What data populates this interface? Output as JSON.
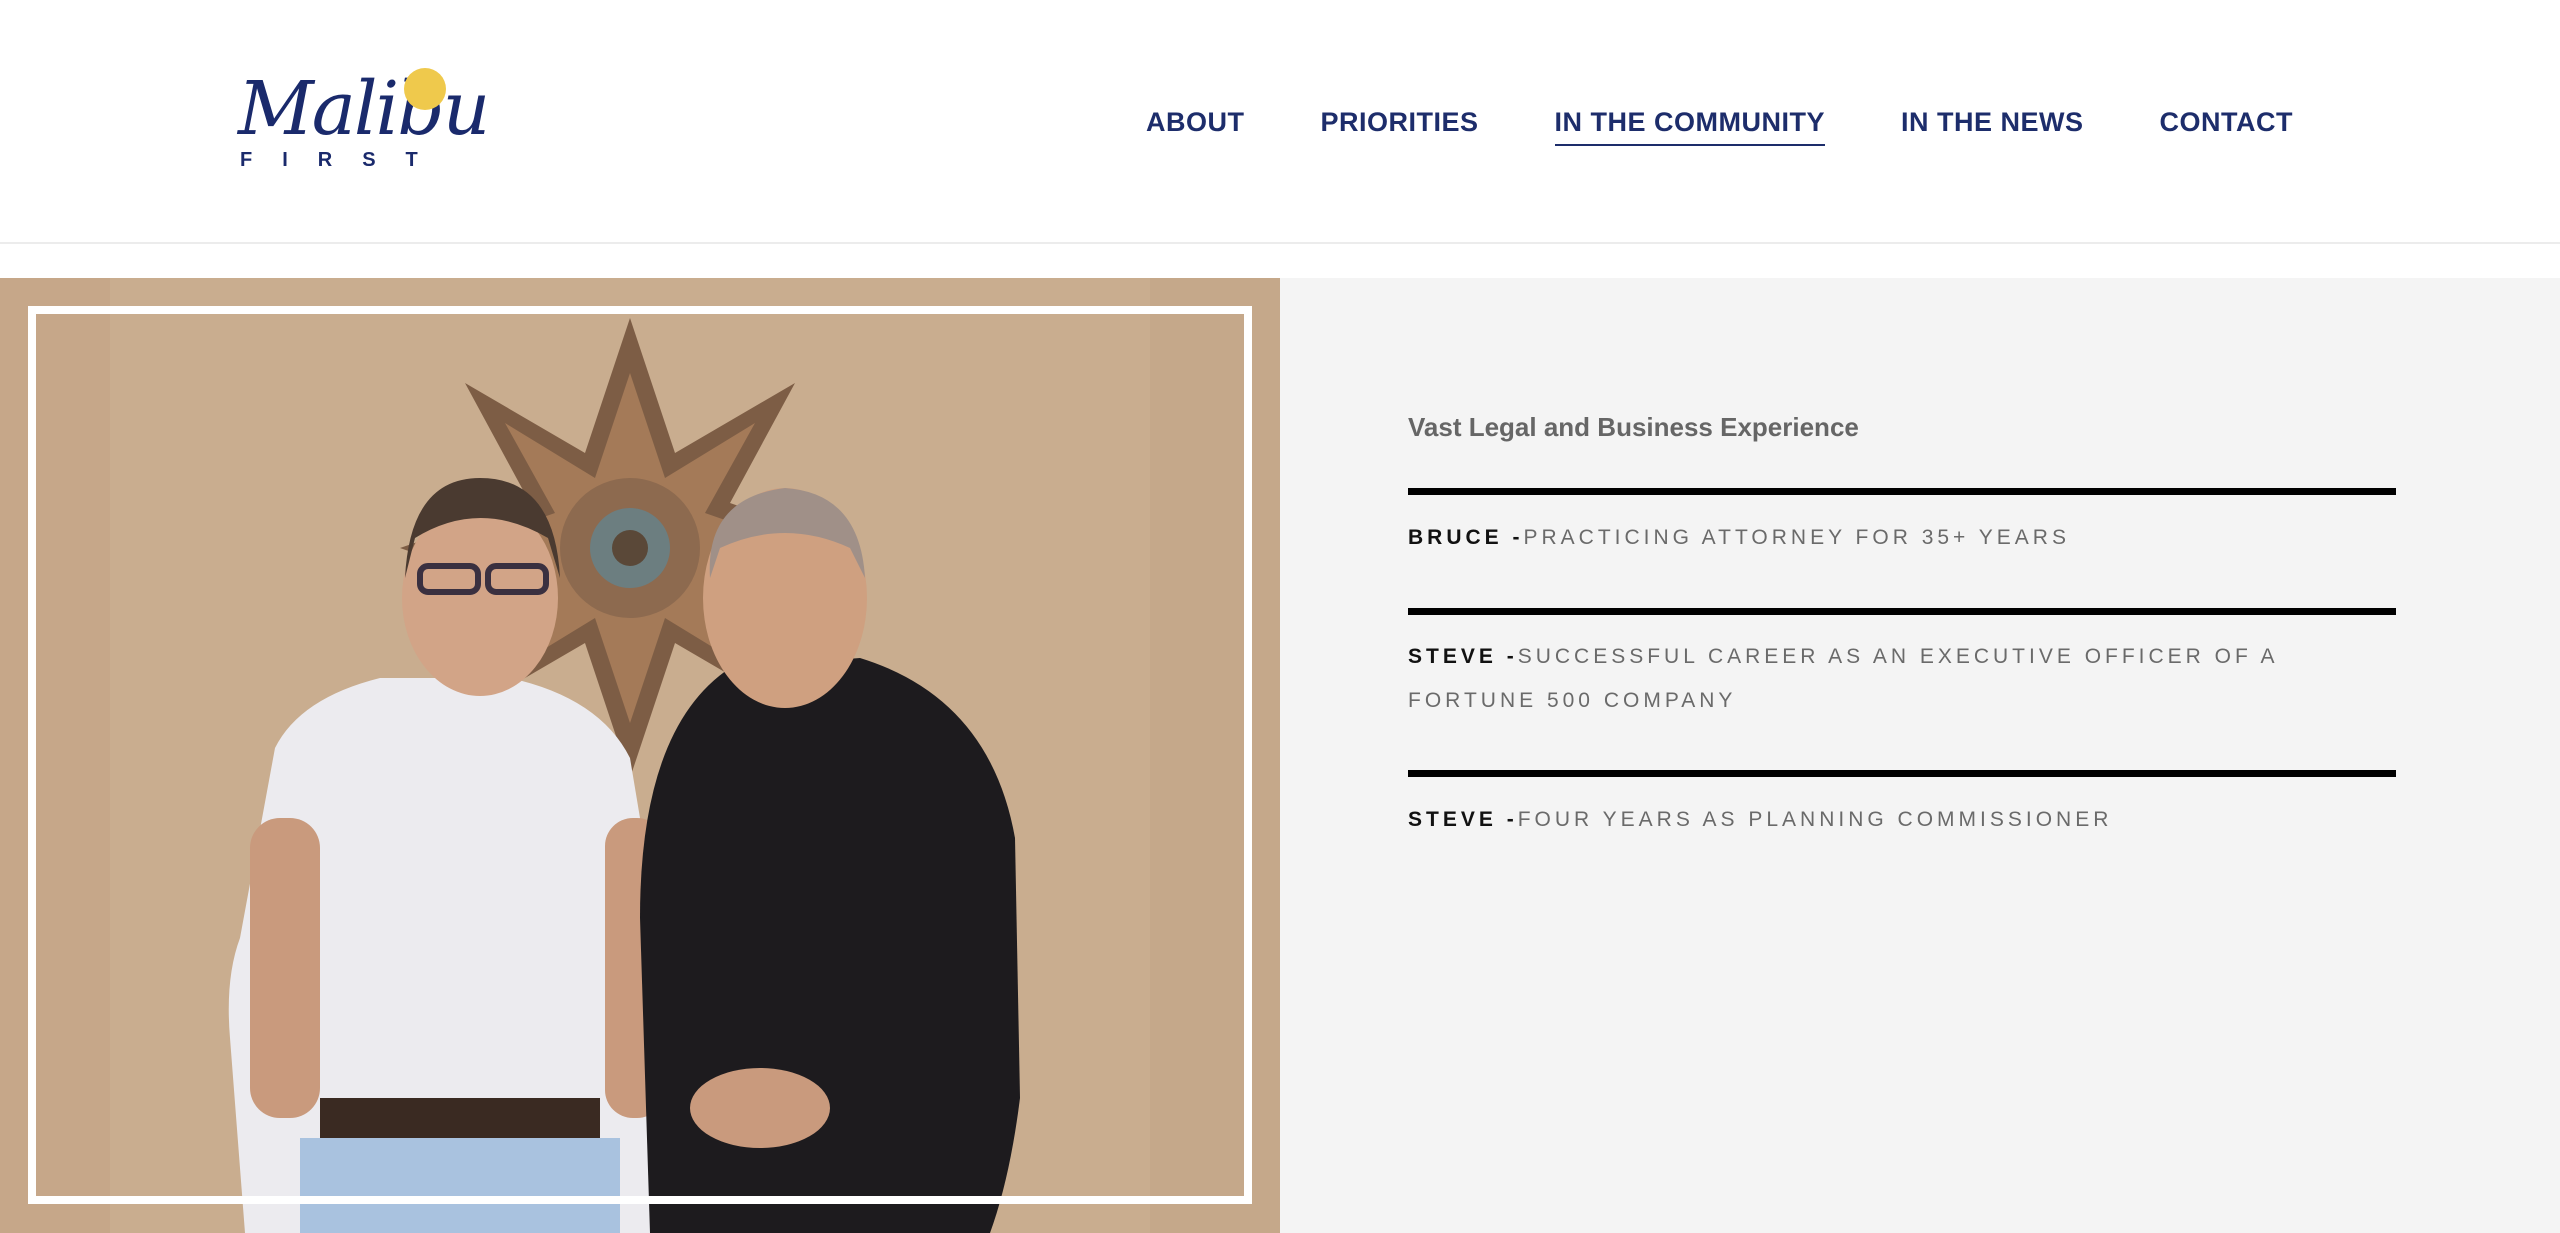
{
  "brand": {
    "logo_script": "Malibu",
    "logo_sub": "FIRST"
  },
  "nav": {
    "items": [
      {
        "label": "ABOUT"
      },
      {
        "label": "PRIORITIES"
      },
      {
        "label": "IN THE COMMUNITY",
        "active": true
      },
      {
        "label": "IN THE NEWS"
      },
      {
        "label": "CONTACT"
      }
    ]
  },
  "colors": {
    "brand_navy": "#1d2d6b",
    "sun_yellow": "#efc94c",
    "panel_bg": "#f4f4f4",
    "wall_tan": "#c8ab8d"
  },
  "photo": {
    "subject": "photo-of-bruce-and-steve"
  },
  "experience": {
    "heading": "Vast Legal and Business Experience",
    "items": [
      {
        "name": "BRUCE -",
        "text": "PRACTICING ATTORNEY FOR 35+ YEARS"
      },
      {
        "name": "STEVE -",
        "text": "SUCCESSFUL CAREER AS AN EXECUTIVE OFFICER OF A FORTUNE 500 COMPANY"
      },
      {
        "name": "STEVE -",
        "text": "FOUR YEARS AS PLANNING COMMISSIONER"
      }
    ]
  }
}
